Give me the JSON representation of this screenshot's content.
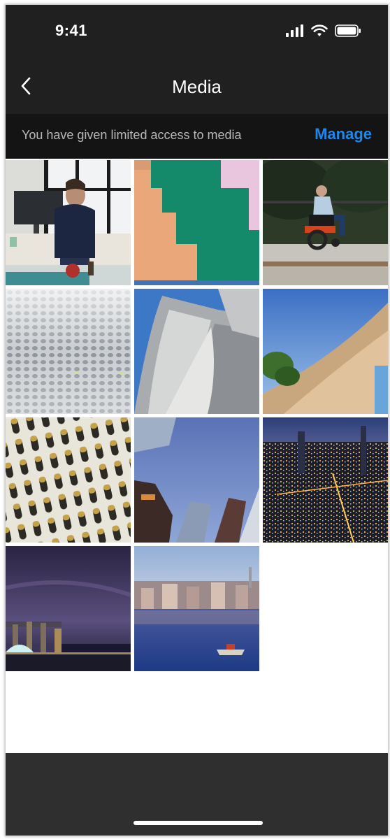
{
  "status_bar": {
    "time": "9:41"
  },
  "nav": {
    "title": "Media",
    "back_icon": "chevron-left-icon"
  },
  "banner": {
    "message": "You have given limited access to media",
    "manage_label": "Manage",
    "accent_color": "#1f86ea"
  },
  "media": {
    "count": 11,
    "items": [
      "office-desk-photo",
      "abstract-orange-green-pink-shapes",
      "person-in-wheelchair-on-path",
      "perforated-metal-closeup",
      "curved-steel-building",
      "curved-facade-against-sky",
      "honeycomb-window-facade",
      "looking-up-at-skyscrapers",
      "city-lights-at-night-aerial",
      "skyline-at-dusk",
      "waterfront-city-with-boat"
    ]
  },
  "colors": {
    "bar_background": "#202020",
    "banner_background": "#141414",
    "bottom_bar": "#2f2f2f"
  }
}
